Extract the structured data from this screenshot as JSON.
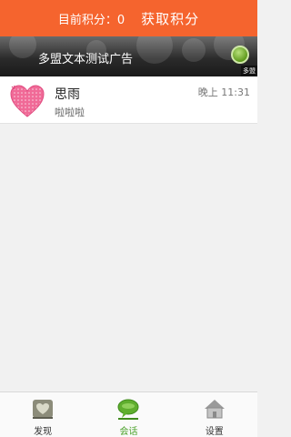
{
  "header": {
    "score_text": "目前积分：0",
    "get_points_label": "获取积分"
  },
  "ad": {
    "text": "多盟文本测试广告",
    "brand": "多盟"
  },
  "conversations": [
    {
      "name": "思雨",
      "time": "晚上 11:31",
      "preview": "啦啦啦",
      "avatar_icon": "pink-heart-icon"
    }
  ],
  "tabs": [
    {
      "label": "发现",
      "icon": "heart-frame-icon",
      "active": false
    },
    {
      "label": "会话",
      "icon": "chat-bubble-icon",
      "active": true
    },
    {
      "label": "设置",
      "icon": "house-icon",
      "active": false
    }
  ],
  "colors": {
    "header_bg": "#f5642e",
    "active_tab": "#4aa12a",
    "avatar_pink": "#f06a97"
  }
}
